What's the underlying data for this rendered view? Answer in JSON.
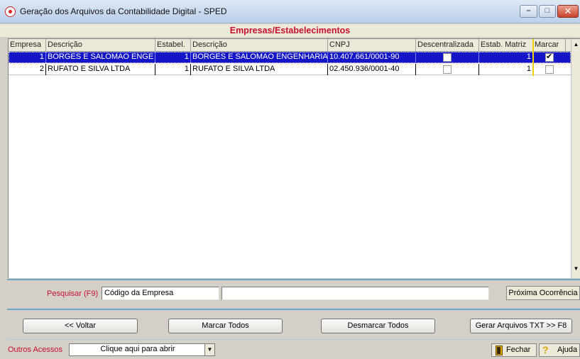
{
  "window": {
    "title": "Geração dos Arquivos da Contabilidade Digital  - SPED",
    "minimize_glyph": "–",
    "maximize_glyph": "□",
    "close_glyph": "✕"
  },
  "section_title": "Empresas/Estabelecimentos",
  "grid": {
    "headers": [
      "Empresa",
      "Descrição",
      "Estabel.",
      "Descrição",
      "CNPJ",
      "Descentralizada",
      "Estab. Matriz",
      "Marcar"
    ],
    "rows": [
      {
        "empresa": "1",
        "descricao_empresa": "BORGES E SALOMAO ENGE",
        "estabel": "1",
        "descricao_estab": "BORGES E SALOMAO ENGENHARIA",
        "cnpj": "10.407.661/0001-90",
        "descentralizada": false,
        "estab_matriz": "1",
        "marcar": true,
        "selected": true
      },
      {
        "empresa": "2",
        "descricao_empresa": "RUFATO E SILVA LTDA",
        "estabel": "1",
        "descricao_estab": "RUFATO E SILVA LTDA",
        "cnpj": "02.450.936/0001-40",
        "descentralizada": false,
        "estab_matriz": "1",
        "marcar": false,
        "selected": false
      }
    ],
    "scroll_up_glyph": "▲",
    "scroll_down_glyph": "▼"
  },
  "search": {
    "label": "Pesquisar (F9)",
    "field_value": "Código da Empresa",
    "search_value": "",
    "next_button": "Próxima Ocorrência"
  },
  "actions": {
    "back": "<< Voltar",
    "mark_all": "Marcar Todos",
    "unmark_all": "Desmarcar Todos",
    "generate": "Gerar Arquivos TXT >> F8"
  },
  "footer": {
    "label": "Outros Acessos",
    "combo_value": "Clique aqui para abrir",
    "combo_arrow": "▼",
    "close_button": "Fechar",
    "help_button": "Ajuda",
    "help_glyph": "?"
  },
  "colors": {
    "accent_red": "#c8102e",
    "selection_blue": "#1515c8",
    "divider_blue": "#6aa6c8"
  }
}
